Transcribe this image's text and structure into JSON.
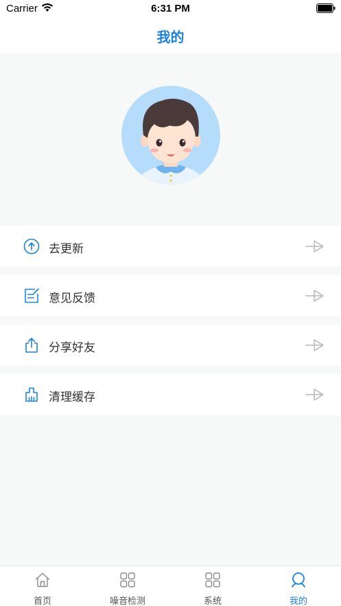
{
  "status_bar": {
    "carrier": "Carrier",
    "time": "6:31 PM"
  },
  "nav": {
    "title": "我的"
  },
  "menu": [
    {
      "label": "去更新",
      "icon": "arrow-up-circle-icon"
    },
    {
      "label": "意见反馈",
      "icon": "edit-note-icon"
    },
    {
      "label": "分享好友",
      "icon": "share-icon"
    },
    {
      "label": "清理缓存",
      "icon": "broom-icon"
    }
  ],
  "tabs": [
    {
      "label": "首页",
      "icon": "home-icon",
      "active": false
    },
    {
      "label": "噪音检测",
      "icon": "grid-icon",
      "active": false
    },
    {
      "label": "系统",
      "icon": "grid-icon",
      "active": false
    },
    {
      "label": "我的",
      "icon": "profile-icon",
      "active": true
    }
  ],
  "colors": {
    "accent": "#1a82e2",
    "background": "#f7f8f8",
    "avatar_bg": "#b5dcfb"
  }
}
